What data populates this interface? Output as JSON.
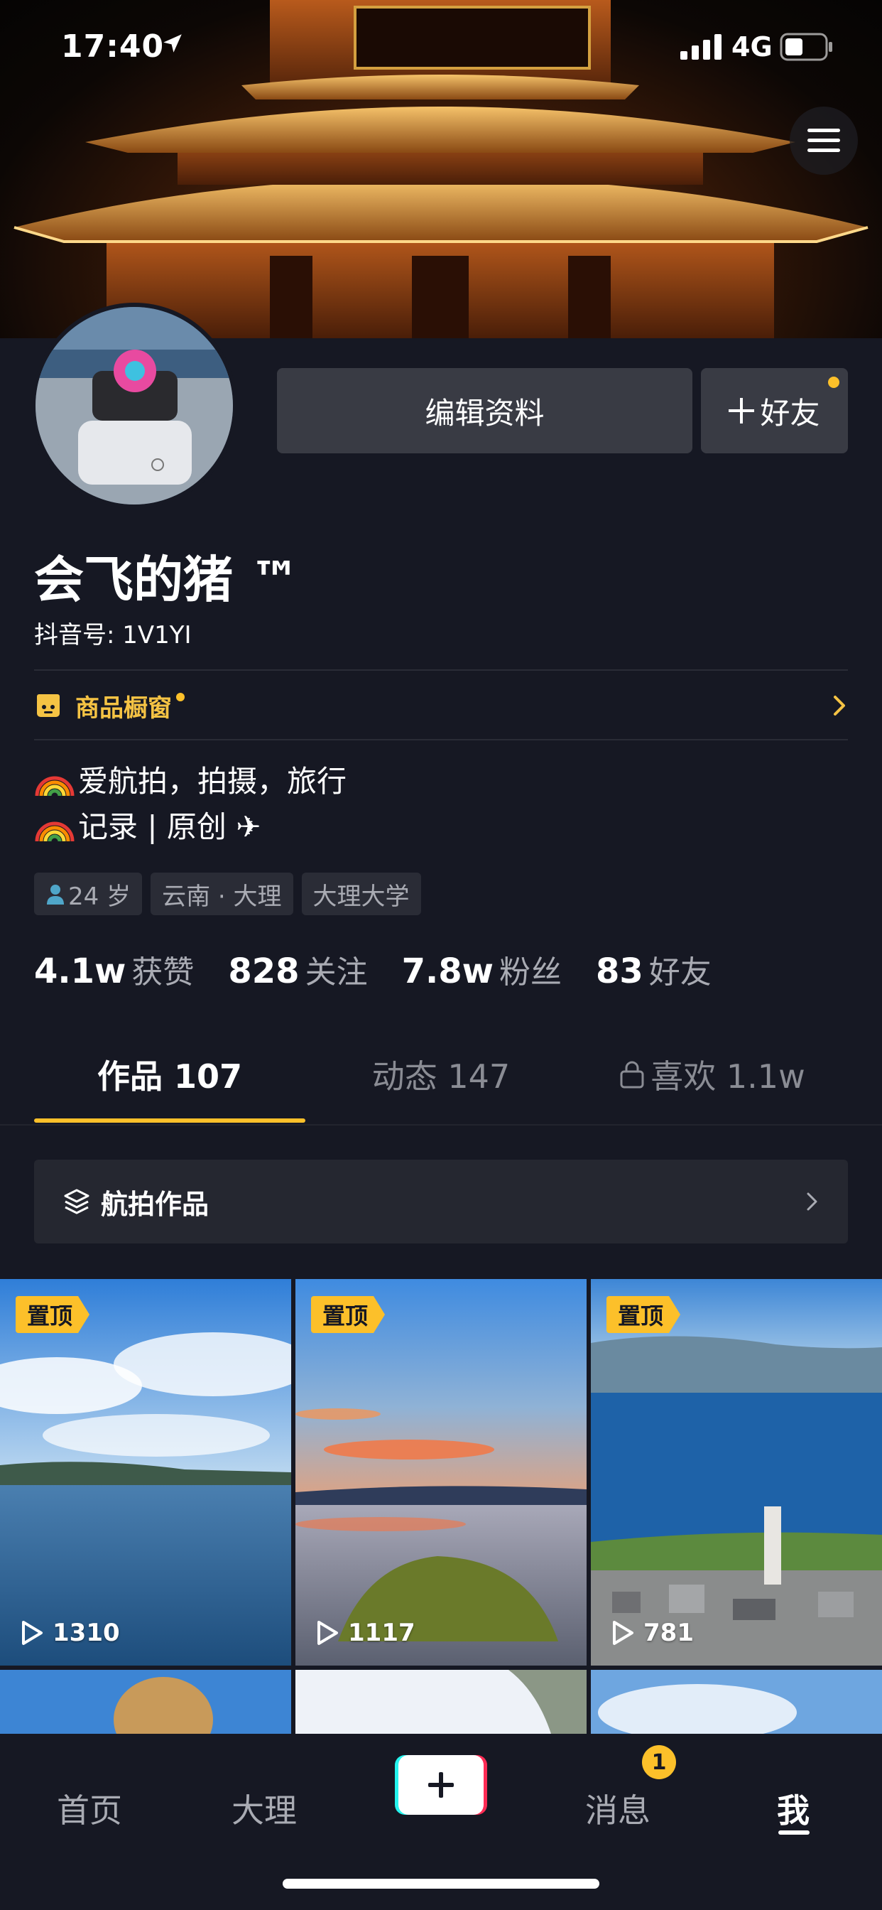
{
  "status_bar": {
    "time": "17:40",
    "network": "4G"
  },
  "profile": {
    "edit_button": "编辑资料",
    "friend_button": "好友",
    "username": "会飞的猪 ™",
    "douyin_id": "抖音号: 1V1YI",
    "shop_label": "商品橱窗",
    "bio_lines": [
      "爱航拍，拍摄，旅行",
      "记录 | 原创 ✈"
    ],
    "tags": {
      "age": "24 岁",
      "location": "云南 · 大理",
      "school": "大理大学"
    },
    "stats": [
      {
        "num": "4.1w",
        "label": "获赞"
      },
      {
        "num": "828",
        "label": "关注"
      },
      {
        "num": "7.8w",
        "label": "粉丝"
      },
      {
        "num": "83",
        "label": "好友"
      }
    ]
  },
  "tabs": [
    {
      "label": "作品 107"
    },
    {
      "label": "动态 147"
    },
    {
      "label": "喜欢 1.1w"
    }
  ],
  "collection": {
    "label": "航拍作品"
  },
  "videos": [
    {
      "pin": "置顶",
      "plays": "1310"
    },
    {
      "pin": "置顶",
      "plays": "1117"
    },
    {
      "pin": "置顶",
      "plays": "781"
    }
  ],
  "bottom_nav": {
    "home": "首页",
    "city": "大理",
    "messages": "消息",
    "messages_badge": "1",
    "me": "我"
  },
  "colors": {
    "accent": "#fcc02a",
    "background": "#161823",
    "button": "#393b44",
    "shop": "#f5c344"
  }
}
